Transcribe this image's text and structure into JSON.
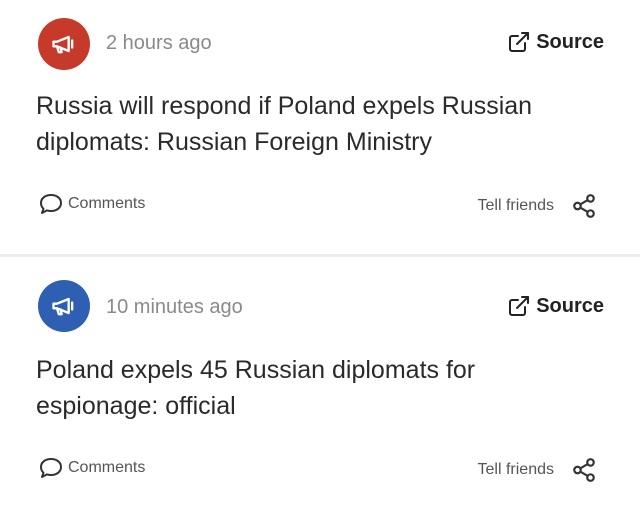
{
  "posts": [
    {
      "time": "2 hours ago",
      "source_label": "Source",
      "headline": "Russia will respond if Poland expels Russian diplomats: Russian Foreign Ministry",
      "comments_label": "Comments",
      "tell_label": "Tell friends",
      "avatar_icon": "megaphone-icon",
      "avatar_color": "#c53a2b"
    },
    {
      "time": "10 minutes ago",
      "source_label": "Source",
      "headline": "Poland expels 45 Russian diplomats for espionage: official",
      "comments_label": "Comments",
      "tell_label": "Tell friends",
      "avatar_icon": "megaphone-icon",
      "avatar_color": "#2f5fb3"
    }
  ]
}
